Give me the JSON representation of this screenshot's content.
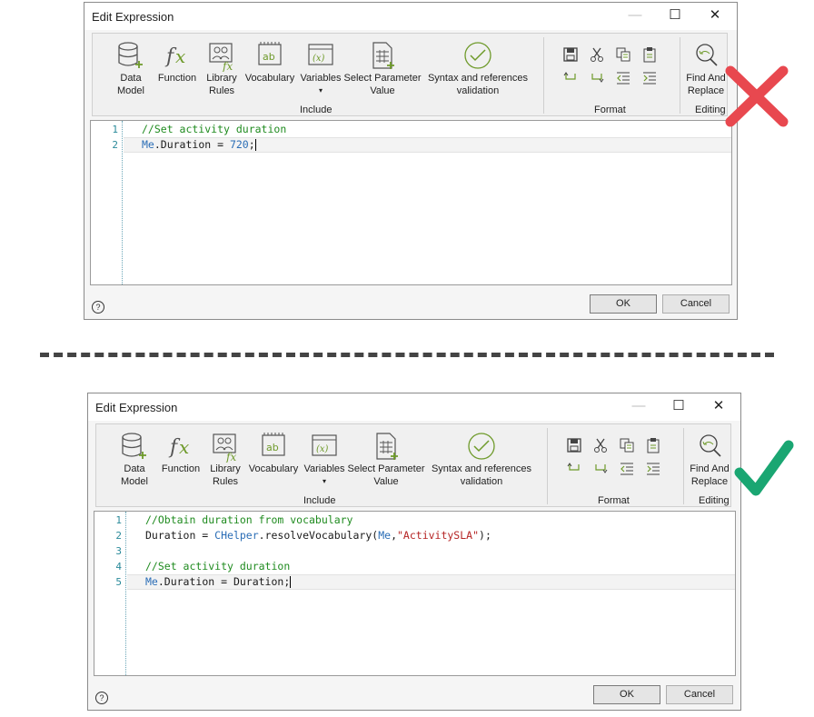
{
  "dialog_top": {
    "title": "Edit Expression",
    "window_controls": {
      "minimize": "—",
      "maximize": "☐",
      "close": "✕"
    },
    "ribbon": {
      "data_model": "Data Model",
      "data_model_l1": "Data",
      "data_model_l2": "Model",
      "function": "Function",
      "library_rules_l1": "Library",
      "library_rules_l2": "Rules",
      "vocabulary": "Vocabulary",
      "variables": "Variables",
      "variables_arrow": "▾",
      "select_parameter_l1": "Select Parameter",
      "select_parameter_l2": "Value",
      "syntax_l1": "Syntax and references",
      "syntax_l2": "validation",
      "group_include": "Include",
      "group_format": "Format",
      "find_l1": "Find And",
      "find_l2": "Replace",
      "group_editing": "Editing"
    },
    "lines": [
      "1",
      "2"
    ],
    "code": {
      "line1": "//Set activity duration",
      "line2_obj": "Me",
      "line2_a": ".Duration = ",
      "line2_num": "720",
      "line2_b": ";"
    },
    "buttons": {
      "ok": "OK",
      "cancel": "Cancel",
      "help": "?"
    },
    "status_mark": "incorrect"
  },
  "dialog_bottom": {
    "title": "Edit Expression",
    "window_controls": {
      "minimize": "—",
      "maximize": "☐",
      "close": "✕"
    },
    "ribbon": {
      "data_model_l1": "Data",
      "data_model_l2": "Model",
      "function": "Function",
      "library_rules_l1": "Library",
      "library_rules_l2": "Rules",
      "vocabulary": "Vocabulary",
      "variables": "Variables",
      "variables_arrow": "▾",
      "select_parameter_l1": "Select Parameter",
      "select_parameter_l2": "Value",
      "syntax_l1": "Syntax and references",
      "syntax_l2": "validation",
      "group_include": "Include",
      "group_format": "Format",
      "find_l1": "Find And",
      "find_l2": "Replace",
      "group_editing": "Editing"
    },
    "lines": [
      "1",
      "2",
      "3",
      "4",
      "5"
    ],
    "code": {
      "line1": "//Obtain duration from vocabulary",
      "line2_a": "Duration = ",
      "line2_obj": "CHelper",
      "line2_b": ".resolveVocabulary(",
      "line2_me": "Me",
      "line2_c": ",",
      "line2_str": "\"ActivitySLA\"",
      "line2_d": ");",
      "line4": "//Set activity duration",
      "line5_obj": "Me",
      "line5_a": ".Duration = Duration;"
    },
    "buttons": {
      "ok": "OK",
      "cancel": "Cancel",
      "help": "?"
    },
    "status_mark": "correct"
  },
  "colors": {
    "wrong": "#e8484f",
    "right": "#1aa672",
    "accent_green": "#6e9a2a",
    "code_comment": "#1f8b1f",
    "code_keyword": "#2a6db6"
  }
}
